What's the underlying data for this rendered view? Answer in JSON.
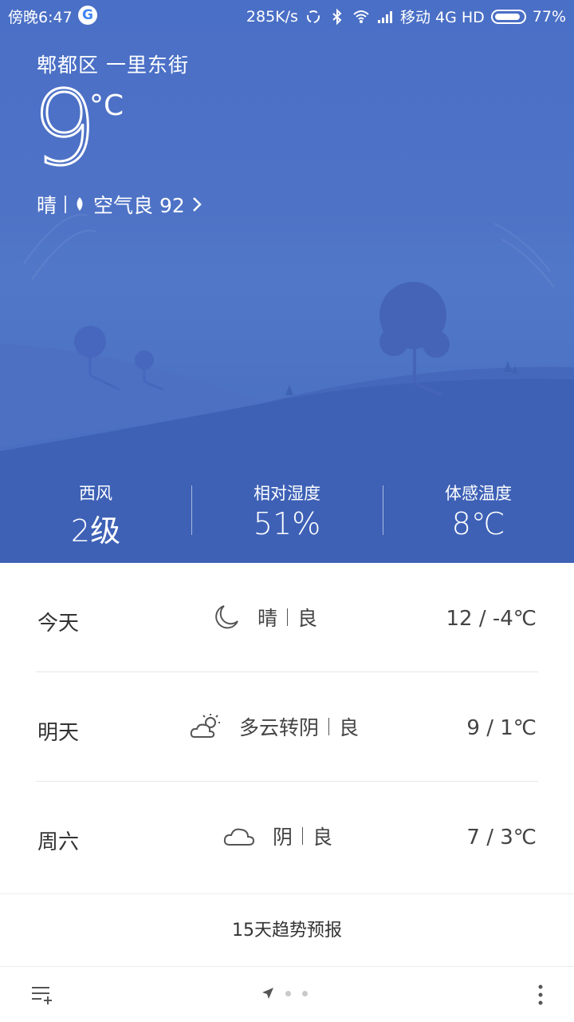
{
  "status_bar": {
    "time": "傍晚6:47",
    "google_badge": "G",
    "net_speed": "285K/s",
    "carrier": "移动 4G HD",
    "battery": "77%"
  },
  "current": {
    "location": "郫都区  一里东街",
    "temperature": "9",
    "unit": "°C",
    "condition": "晴",
    "aqi_text": "空气良 92"
  },
  "stats": [
    {
      "label": "西风",
      "value": "2级"
    },
    {
      "label": "相对湿度",
      "value": "51%"
    },
    {
      "label": "体感温度",
      "value": "8℃"
    }
  ],
  "forecast": [
    {
      "day": "今天",
      "icon": "moon-icon",
      "condition": "晴",
      "air": "良",
      "temp": "12 / -4℃"
    },
    {
      "day": "明天",
      "icon": "partly-cloudy-icon",
      "condition": "多云转阴",
      "air": "良",
      "temp": "9 / 1℃"
    },
    {
      "day": "周六",
      "icon": "cloud-icon",
      "condition": "阴",
      "air": "良",
      "temp": "7 / 3℃"
    }
  ],
  "trend_label": "15天趋势预报",
  "colors": {
    "sky": "#4a6fc6",
    "hill": "#3f62b8"
  }
}
